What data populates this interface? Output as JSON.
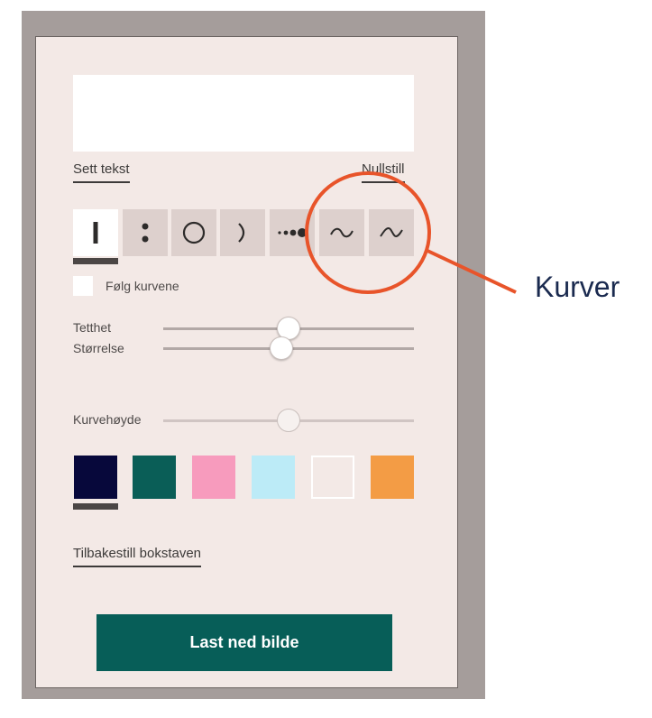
{
  "editor": {
    "text_value": "",
    "set_text_label": "Sett tekst",
    "reset_label": "Nullstill"
  },
  "tools": [
    {
      "name": "line",
      "icon": "vertical-line-icon",
      "selected": true
    },
    {
      "name": "dots",
      "icon": "two-dots-icon",
      "selected": false
    },
    {
      "name": "circle",
      "icon": "circle-icon",
      "selected": false
    },
    {
      "name": "arc",
      "icon": "arc-icon",
      "selected": false
    },
    {
      "name": "graduated-dots",
      "icon": "graduated-dots-icon",
      "selected": false
    },
    {
      "name": "wave",
      "icon": "wave-icon",
      "selected": false
    },
    {
      "name": "peak",
      "icon": "peak-icon",
      "selected": false
    }
  ],
  "follow_curves": {
    "label": "Følg kurvene",
    "checked": false
  },
  "sliders": [
    {
      "label": "Tetthet",
      "value": 0.5,
      "enabled": true
    },
    {
      "label": "Størrelse",
      "value": 0.47,
      "enabled": true
    },
    {
      "label": "Kurvehøyde",
      "value": 0.5,
      "enabled": false
    }
  ],
  "colors": [
    "#07083b",
    "#0a5e57",
    "#f79bbd",
    "#bcebf7",
    "#f3e9e6",
    "#f39c45"
  ],
  "selected_color_index": 0,
  "reset_letter_label": "Tilbakestill bokstaven",
  "download_label": "Last ned bilde",
  "annotation": {
    "label": "Kurver",
    "color": "#e8542a"
  }
}
